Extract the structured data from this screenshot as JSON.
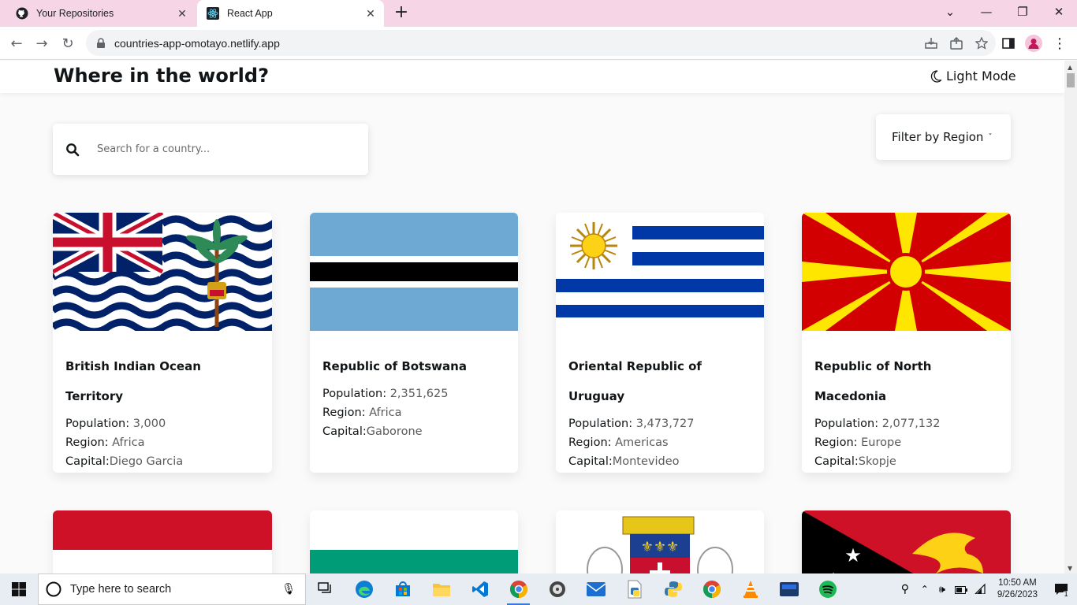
{
  "browser": {
    "tabs": [
      {
        "title": "Your Repositories",
        "active": false
      },
      {
        "title": "React App",
        "active": true
      }
    ],
    "url": "countries-app-omotayo.netlify.app"
  },
  "app": {
    "title": "Where in the world?",
    "mode_label": "Light Mode",
    "search_placeholder": "Search for a country...",
    "filter_label": "Filter by Region"
  },
  "cards": [
    {
      "name": "British Indian Ocean Territory",
      "population_label": "Population",
      "population": "3,000",
      "region_label": "Region",
      "region": "Africa",
      "capital_label": "Capital",
      "capital": "Diego Garcia"
    },
    {
      "name": "Republic of Botswana",
      "population_label": "Population",
      "population": "2,351,625",
      "region_label": "Region",
      "region": "Africa",
      "capital_label": "Capital",
      "capital": "Gaborone"
    },
    {
      "name_line1": "Oriental Republic of",
      "name_line2": "Uruguay",
      "population_label": "Population",
      "population": "3,473,727",
      "region_label": "Region",
      "region": "Americas",
      "capital_label": "Capital",
      "capital": "Montevideo"
    },
    {
      "name_line1": "Republic of North",
      "name_line2": "Macedonia",
      "population_label": "Population",
      "population": "2,077,132",
      "region_label": "Region",
      "region": "Europe",
      "capital_label": "Capital",
      "capital": "Skopje"
    }
  ],
  "taskbar": {
    "search_placeholder": "Type here to search",
    "time": "10:50 AM",
    "date": "9/26/2023",
    "notification_count": "1"
  },
  "colors": {
    "tabstrip": "#f6d5e6",
    "page_bg": "#fafafa",
    "text": "#111517"
  }
}
